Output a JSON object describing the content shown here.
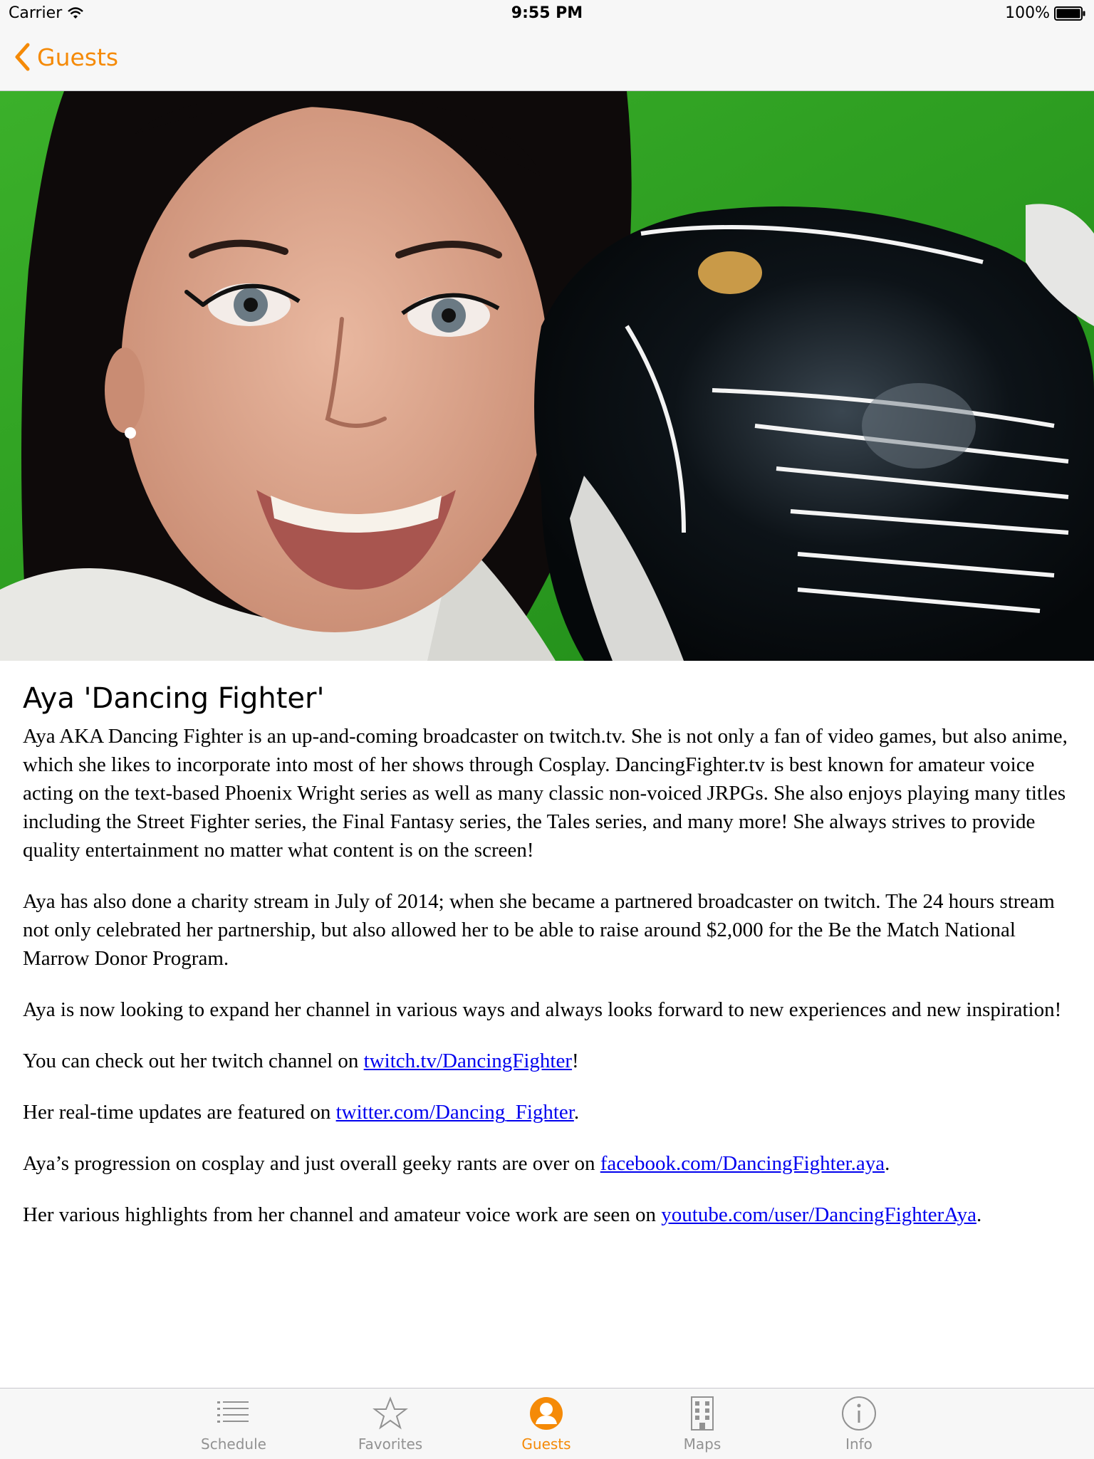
{
  "status_bar": {
    "carrier": "Carrier",
    "time": "9:55 PM",
    "battery": "100%"
  },
  "nav": {
    "back_label": "Guests"
  },
  "guest": {
    "name": "Aya 'Dancing Fighter'",
    "photo_icon": "guest-photo"
  },
  "bio": {
    "p1": "Aya AKA Dancing Fighter is an up-and-coming broadcaster on twitch.tv. She is not only a fan of video games, but also anime, which she likes to incorporate into most of her shows through Cosplay. DancingFighter.tv is best known for amateur voice acting on the text-based Phoenix Wright series as well as many classic non-voiced JRPGs. She also enjoys playing many titles including the Street Fighter series, the Final Fantasy series, the Tales series, and many more! She always strives to provide quality entertainment no matter what content is on the screen!",
    "p2": "Aya has also done a charity stream in July of 2014; when she became a partnered broadcaster on twitch. The 24 hours stream not only celebrated her partnership, but also allowed her to be able to raise around $2,000 for the Be the Match National Marrow Donor Program.",
    "p3": "Aya is now looking to expand her channel in various ways and always looks forward to new experiences and new inspiration!",
    "p4_prefix": "You can check out her twitch channel on ",
    "p4_link": "twitch.tv/DancingFighter",
    "p4_suffix": "!",
    "p5_prefix": "Her real-time updates are featured on ",
    "p5_link": "twitter.com/Dancing_Fighter",
    "p5_suffix": ".",
    "p6_prefix": "Aya’s progression on cosplay and just overall geeky rants are over on ",
    "p6_link": "facebook.com/DancingFighter.aya",
    "p6_suffix": ".",
    "p7_prefix": "Her various highlights from her channel and amateur voice work are seen on ",
    "p7_link": "youtube.com/user/DancingFighterAya",
    "p7_suffix": "."
  },
  "tabs": [
    {
      "label": "Schedule",
      "icon": "list-icon",
      "active": false
    },
    {
      "label": "Favorites",
      "icon": "star-icon",
      "active": false
    },
    {
      "label": "Guests",
      "icon": "person-icon",
      "active": true
    },
    {
      "label": "Maps",
      "icon": "building-icon",
      "active": false
    },
    {
      "label": "Info",
      "icon": "info-icon",
      "active": false
    }
  ],
  "colors": {
    "accent": "#f58a07",
    "inactive": "#929292",
    "link": "#0000ee",
    "hero_background": "#2a9e1f"
  }
}
